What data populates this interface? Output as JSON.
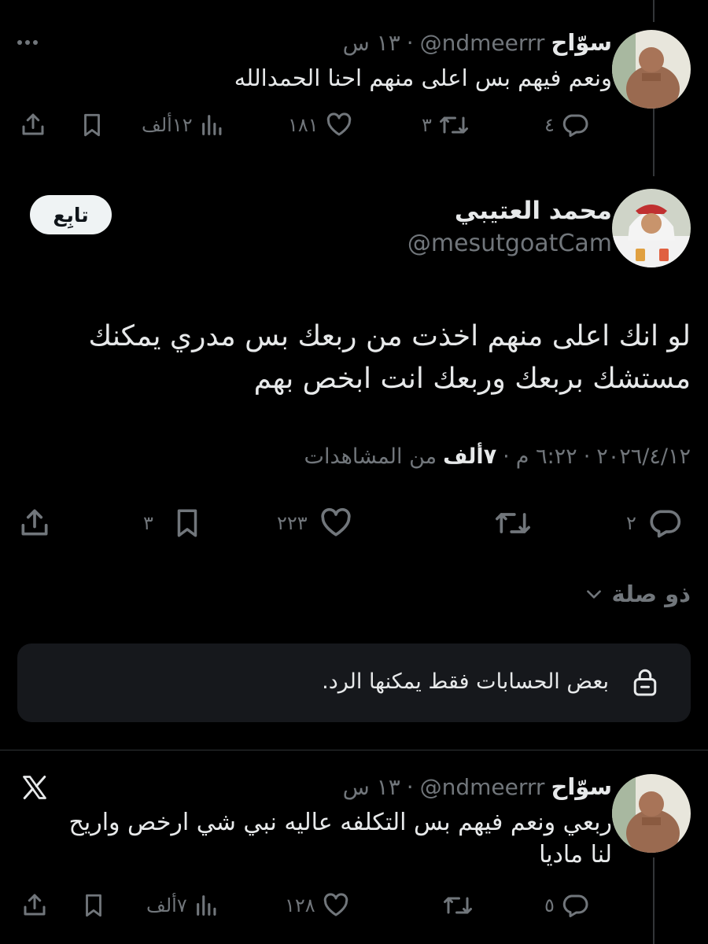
{
  "tweet1": {
    "name": "سوّاح",
    "handle": "@ndmeerrr",
    "separator": "·",
    "time": "١٣ س",
    "text": "ونعم فيهم بس اعلى منهم احنا الحمدالله",
    "replies": "٤",
    "retweets": "٣",
    "likes": "١٨١",
    "views": "١٢ألف"
  },
  "main": {
    "name": "محمد العتيبي",
    "handle": "@mesutgoatCam",
    "follow_label": "تابِع",
    "text_line1": "لو انك اعلى منهم اخذت من ربعك بس مدري يمكنك",
    "text_line2": "مستشك بربعك وربعك انت ابخص بهم",
    "date": "٢٠٢٦/٤/١٢",
    "dot": "·",
    "time": "٦:٢٢ م",
    "views_count": "٧ألف",
    "views_label": "من المشاهدات",
    "replies": "٢",
    "likes": "٢٢٣",
    "bookmarks": "٣"
  },
  "related": {
    "label": "ذو صلة"
  },
  "reply_restriction": {
    "text": "بعض الحسابات فقط يمكنها الرد."
  },
  "tweet2": {
    "name": "سوّاح",
    "handle": "@ndmeerrr",
    "separator": "·",
    "time": "١٣ س",
    "text_line1": "ربعي ونعم فيهم بس التكلفه عاليه نبي شي ارخص واريح",
    "text_line2": "لنا ماديا",
    "replies": "٥",
    "likes": "١٢٨",
    "views": "٧ألف"
  },
  "icons": [
    "more-icon",
    "reply-icon",
    "retweet-icon",
    "like-icon",
    "views-icon",
    "bookmark-icon",
    "share-icon",
    "chevron-down-icon",
    "lock-icon",
    "x-logo-icon"
  ]
}
